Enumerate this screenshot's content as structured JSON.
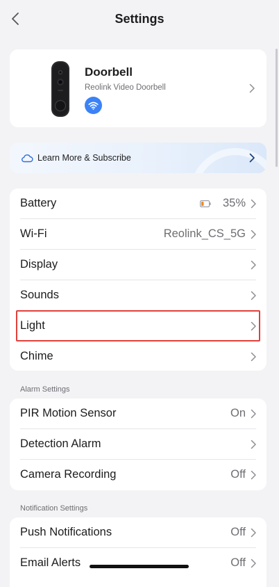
{
  "nav": {
    "title": "Settings",
    "back_icon": "chevron-left-icon"
  },
  "device": {
    "name": "Doorbell",
    "model": "Reolink Video Doorbell",
    "status_icon": "wifi-icon",
    "accent_color": "#3b82f6"
  },
  "subscribe": {
    "label": "Learn More & Subscribe",
    "icon": "cloud-icon"
  },
  "main_settings": [
    {
      "label": "Battery",
      "value": "35%",
      "icon": "battery-icon",
      "battery_level": 0.35
    },
    {
      "label": "Wi-Fi",
      "value": "Reolink_CS_5G"
    },
    {
      "label": "Display",
      "value": ""
    },
    {
      "label": "Sounds",
      "value": ""
    },
    {
      "label": "Light",
      "value": "",
      "highlighted": true
    },
    {
      "label": "Chime",
      "value": ""
    }
  ],
  "alarm_section": {
    "header": "Alarm Settings",
    "items": [
      {
        "label": "PIR Motion Sensor",
        "value": "On"
      },
      {
        "label": "Detection Alarm",
        "value": ""
      },
      {
        "label": "Camera Recording",
        "value": "Off"
      }
    ]
  },
  "notification_section": {
    "header": "Notification Settings",
    "items": [
      {
        "label": "Push Notifications",
        "value": "Off"
      },
      {
        "label": "Email Alerts",
        "value": "Off"
      }
    ]
  },
  "colors": {
    "background": "#f3f3f5",
    "card": "#ffffff",
    "highlight_border": "#e0403b",
    "secondary_text": "#6e6e73"
  }
}
